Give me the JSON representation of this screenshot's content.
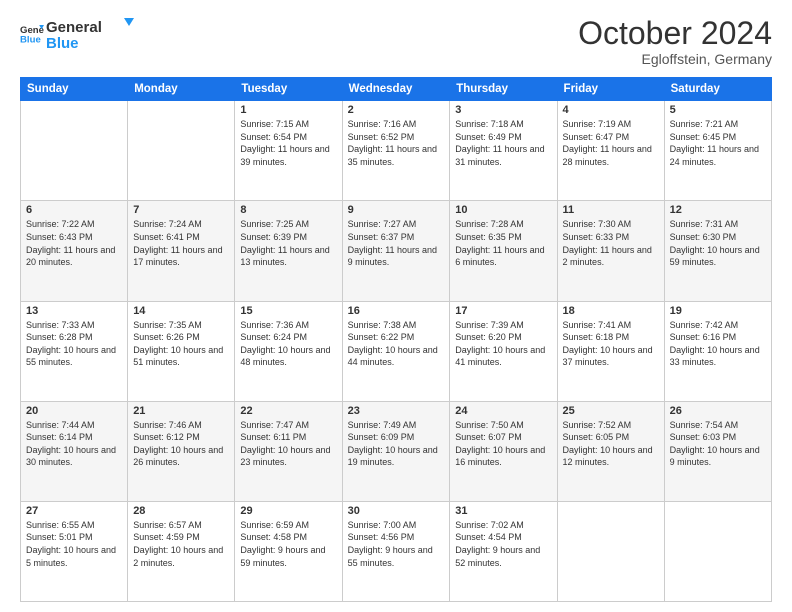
{
  "header": {
    "logo_line1": "General",
    "logo_line2": "Blue",
    "main_title": "October 2024",
    "subtitle": "Egloffstein, Germany"
  },
  "weekdays": [
    "Sunday",
    "Monday",
    "Tuesday",
    "Wednesday",
    "Thursday",
    "Friday",
    "Saturday"
  ],
  "weeks": [
    [
      {
        "num": "",
        "info": ""
      },
      {
        "num": "",
        "info": ""
      },
      {
        "num": "1",
        "info": "Sunrise: 7:15 AM\nSunset: 6:54 PM\nDaylight: 11 hours and 39 minutes."
      },
      {
        "num": "2",
        "info": "Sunrise: 7:16 AM\nSunset: 6:52 PM\nDaylight: 11 hours and 35 minutes."
      },
      {
        "num": "3",
        "info": "Sunrise: 7:18 AM\nSunset: 6:49 PM\nDaylight: 11 hours and 31 minutes."
      },
      {
        "num": "4",
        "info": "Sunrise: 7:19 AM\nSunset: 6:47 PM\nDaylight: 11 hours and 28 minutes."
      },
      {
        "num": "5",
        "info": "Sunrise: 7:21 AM\nSunset: 6:45 PM\nDaylight: 11 hours and 24 minutes."
      }
    ],
    [
      {
        "num": "6",
        "info": "Sunrise: 7:22 AM\nSunset: 6:43 PM\nDaylight: 11 hours and 20 minutes."
      },
      {
        "num": "7",
        "info": "Sunrise: 7:24 AM\nSunset: 6:41 PM\nDaylight: 11 hours and 17 minutes."
      },
      {
        "num": "8",
        "info": "Sunrise: 7:25 AM\nSunset: 6:39 PM\nDaylight: 11 hours and 13 minutes."
      },
      {
        "num": "9",
        "info": "Sunrise: 7:27 AM\nSunset: 6:37 PM\nDaylight: 11 hours and 9 minutes."
      },
      {
        "num": "10",
        "info": "Sunrise: 7:28 AM\nSunset: 6:35 PM\nDaylight: 11 hours and 6 minutes."
      },
      {
        "num": "11",
        "info": "Sunrise: 7:30 AM\nSunset: 6:33 PM\nDaylight: 11 hours and 2 minutes."
      },
      {
        "num": "12",
        "info": "Sunrise: 7:31 AM\nSunset: 6:30 PM\nDaylight: 10 hours and 59 minutes."
      }
    ],
    [
      {
        "num": "13",
        "info": "Sunrise: 7:33 AM\nSunset: 6:28 PM\nDaylight: 10 hours and 55 minutes."
      },
      {
        "num": "14",
        "info": "Sunrise: 7:35 AM\nSunset: 6:26 PM\nDaylight: 10 hours and 51 minutes."
      },
      {
        "num": "15",
        "info": "Sunrise: 7:36 AM\nSunset: 6:24 PM\nDaylight: 10 hours and 48 minutes."
      },
      {
        "num": "16",
        "info": "Sunrise: 7:38 AM\nSunset: 6:22 PM\nDaylight: 10 hours and 44 minutes."
      },
      {
        "num": "17",
        "info": "Sunrise: 7:39 AM\nSunset: 6:20 PM\nDaylight: 10 hours and 41 minutes."
      },
      {
        "num": "18",
        "info": "Sunrise: 7:41 AM\nSunset: 6:18 PM\nDaylight: 10 hours and 37 minutes."
      },
      {
        "num": "19",
        "info": "Sunrise: 7:42 AM\nSunset: 6:16 PM\nDaylight: 10 hours and 33 minutes."
      }
    ],
    [
      {
        "num": "20",
        "info": "Sunrise: 7:44 AM\nSunset: 6:14 PM\nDaylight: 10 hours and 30 minutes."
      },
      {
        "num": "21",
        "info": "Sunrise: 7:46 AM\nSunset: 6:12 PM\nDaylight: 10 hours and 26 minutes."
      },
      {
        "num": "22",
        "info": "Sunrise: 7:47 AM\nSunset: 6:11 PM\nDaylight: 10 hours and 23 minutes."
      },
      {
        "num": "23",
        "info": "Sunrise: 7:49 AM\nSunset: 6:09 PM\nDaylight: 10 hours and 19 minutes."
      },
      {
        "num": "24",
        "info": "Sunrise: 7:50 AM\nSunset: 6:07 PM\nDaylight: 10 hours and 16 minutes."
      },
      {
        "num": "25",
        "info": "Sunrise: 7:52 AM\nSunset: 6:05 PM\nDaylight: 10 hours and 12 minutes."
      },
      {
        "num": "26",
        "info": "Sunrise: 7:54 AM\nSunset: 6:03 PM\nDaylight: 10 hours and 9 minutes."
      }
    ],
    [
      {
        "num": "27",
        "info": "Sunrise: 6:55 AM\nSunset: 5:01 PM\nDaylight: 10 hours and 5 minutes."
      },
      {
        "num": "28",
        "info": "Sunrise: 6:57 AM\nSunset: 4:59 PM\nDaylight: 10 hours and 2 minutes."
      },
      {
        "num": "29",
        "info": "Sunrise: 6:59 AM\nSunset: 4:58 PM\nDaylight: 9 hours and 59 minutes."
      },
      {
        "num": "30",
        "info": "Sunrise: 7:00 AM\nSunset: 4:56 PM\nDaylight: 9 hours and 55 minutes."
      },
      {
        "num": "31",
        "info": "Sunrise: 7:02 AM\nSunset: 4:54 PM\nDaylight: 9 hours and 52 minutes."
      },
      {
        "num": "",
        "info": ""
      },
      {
        "num": "",
        "info": ""
      }
    ]
  ]
}
